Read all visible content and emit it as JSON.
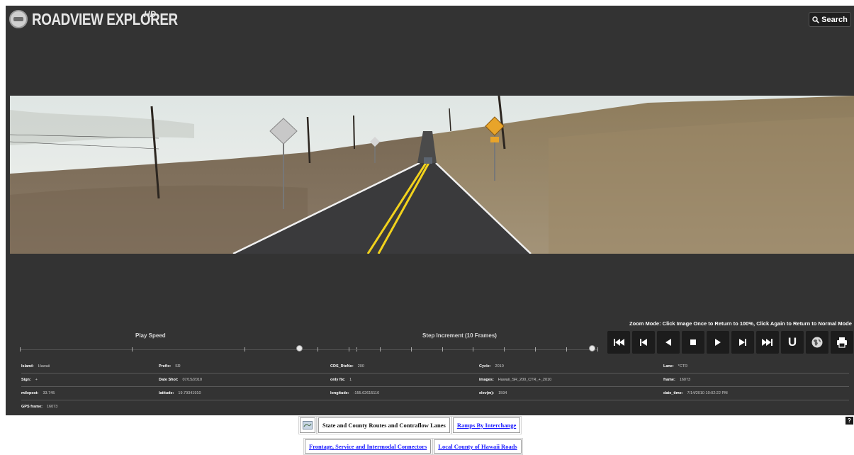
{
  "header": {
    "title": "ROADVIEW EXPLORER",
    "badge": "HD",
    "search_label": "Search"
  },
  "zoom_hint": "Zoom Mode: Click Image Once to Return to 100%, Click Again to Return to Normal Mode",
  "play_speed": {
    "label": "Play Speed",
    "level": 0.83
  },
  "step_increment": {
    "label": "Step Increment (10 Frames)",
    "level": 0.98
  },
  "controls": [
    {
      "name": "first-frame",
      "icon": "skip-to-start-icon"
    },
    {
      "name": "previous-frame",
      "icon": "step-back-icon"
    },
    {
      "name": "play-reverse",
      "icon": "play-reverse-icon"
    },
    {
      "name": "stop",
      "icon": "stop-icon"
    },
    {
      "name": "play-forward",
      "icon": "play-icon"
    },
    {
      "name": "next-frame",
      "icon": "step-forward-icon"
    },
    {
      "name": "last-frame",
      "icon": "skip-to-end-icon"
    },
    {
      "name": "u-turn",
      "icon": "u-turn-icon",
      "label": "U"
    },
    {
      "name": "globe",
      "icon": "globe-icon"
    },
    {
      "name": "print",
      "icon": "printer-icon"
    }
  ],
  "info": {
    "rows": [
      [
        {
          "key": "Island:",
          "value": "Hawaii"
        },
        {
          "key": "Prefix:",
          "value": "SR"
        },
        {
          "key": "CDS_RteNo:",
          "value": "200"
        },
        {
          "key": "Cycle:",
          "value": "2010"
        },
        {
          "key": "Lane:",
          "value": "*CTR"
        }
      ],
      [
        {
          "key": "Sign:",
          "value": "+"
        },
        {
          "key": "Date Shot:",
          "value": "07/15/2010"
        },
        {
          "key": "only fix:",
          "value": "1"
        },
        {
          "key": "images:",
          "value": "Hawaii_SR_200_CTR_+_2010"
        },
        {
          "key": "frame:",
          "value": "16073"
        }
      ],
      [
        {
          "key": "milepost:",
          "value": "33.745"
        },
        {
          "key": "latitude:",
          "value": "19.79341910"
        },
        {
          "key": "longitude:",
          "value": "-155.62615110"
        },
        {
          "key": "elev(m):",
          "value": "1594"
        },
        {
          "key": "date_time:",
          "value": "7/14/2010 10:02:22 PM"
        }
      ],
      [
        {
          "key": "GPS frame:",
          "value": "16073"
        }
      ]
    ]
  },
  "help_label": "?",
  "links": {
    "map_icon": "map-icon",
    "active": "State and County Routes and Contraflow Lanes",
    "ramps": "Ramps By Interchange",
    "frontage": "Frontage, Service and Intermodal Connectors",
    "local": "Local County of Hawaii Roads"
  },
  "colors": {
    "background": "#333333",
    "link": "#1a1aff",
    "road_line": "#f2d21c"
  }
}
